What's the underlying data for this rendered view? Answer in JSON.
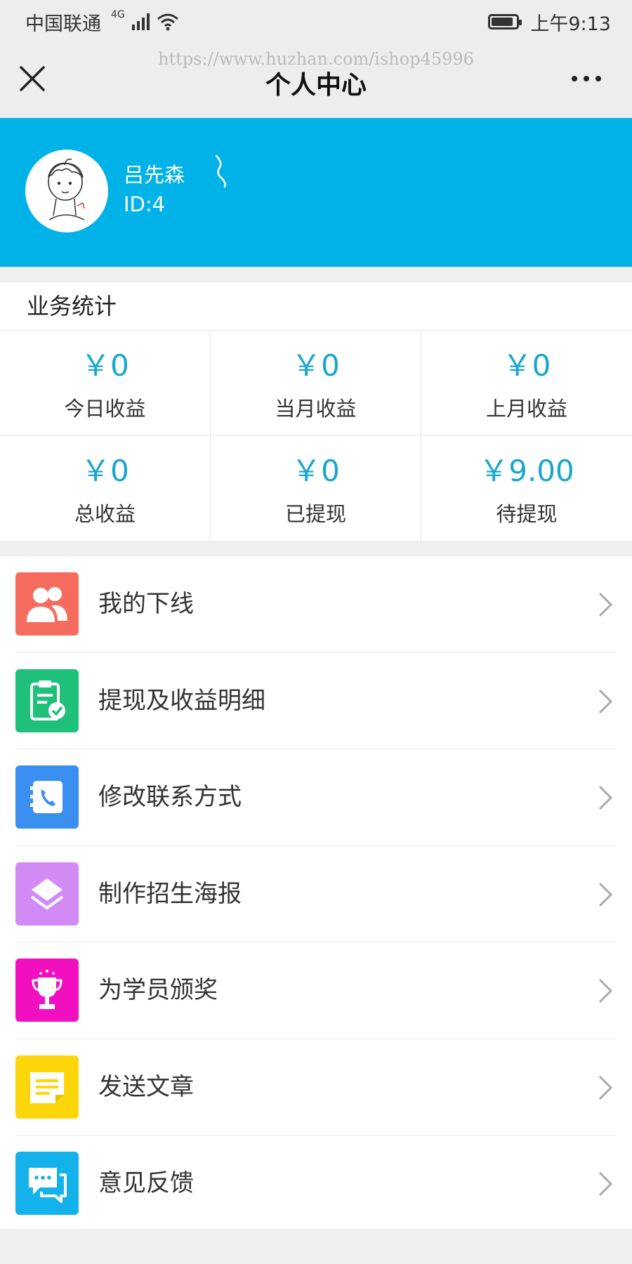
{
  "status_bar": {
    "carrier": "中国联通",
    "network": "4G",
    "time": "上午9:13"
  },
  "nav": {
    "title": "个人中心",
    "watermark": "https://www.huzhan.com/ishop45996"
  },
  "profile": {
    "name": "吕先森",
    "id": "ID:4"
  },
  "stats": {
    "title": "业务统计",
    "items": [
      {
        "value": "￥0",
        "label": "今日收益"
      },
      {
        "value": "￥0",
        "label": "当月收益"
      },
      {
        "value": "￥0",
        "label": "上月收益"
      },
      {
        "value": "￥0",
        "label": "总收益"
      },
      {
        "value": "￥0",
        "label": "已提现"
      },
      {
        "value": "￥9.00",
        "label": "待提现"
      }
    ]
  },
  "menu": {
    "items": [
      {
        "label": "我的下线",
        "icon": "users-icon",
        "color": "#f56b5e"
      },
      {
        "label": "提现及收益明细",
        "icon": "clipboard-check-icon",
        "color": "#1ec07a"
      },
      {
        "label": "修改联系方式",
        "icon": "phone-book-icon",
        "color": "#3b8ff0"
      },
      {
        "label": "制作招生海报",
        "icon": "layers-icon",
        "color": "#d28af5"
      },
      {
        "label": "为学员颁奖",
        "icon": "trophy-icon",
        "color": "#f20fc0"
      },
      {
        "label": "发送文章",
        "icon": "document-icon",
        "color": "#fcd60a"
      },
      {
        "label": "意见反馈",
        "icon": "chat-icon",
        "color": "#13b2ea"
      }
    ]
  },
  "colors": {
    "header_blue": "#00b2e8",
    "stat_value": "#19a6cf"
  }
}
